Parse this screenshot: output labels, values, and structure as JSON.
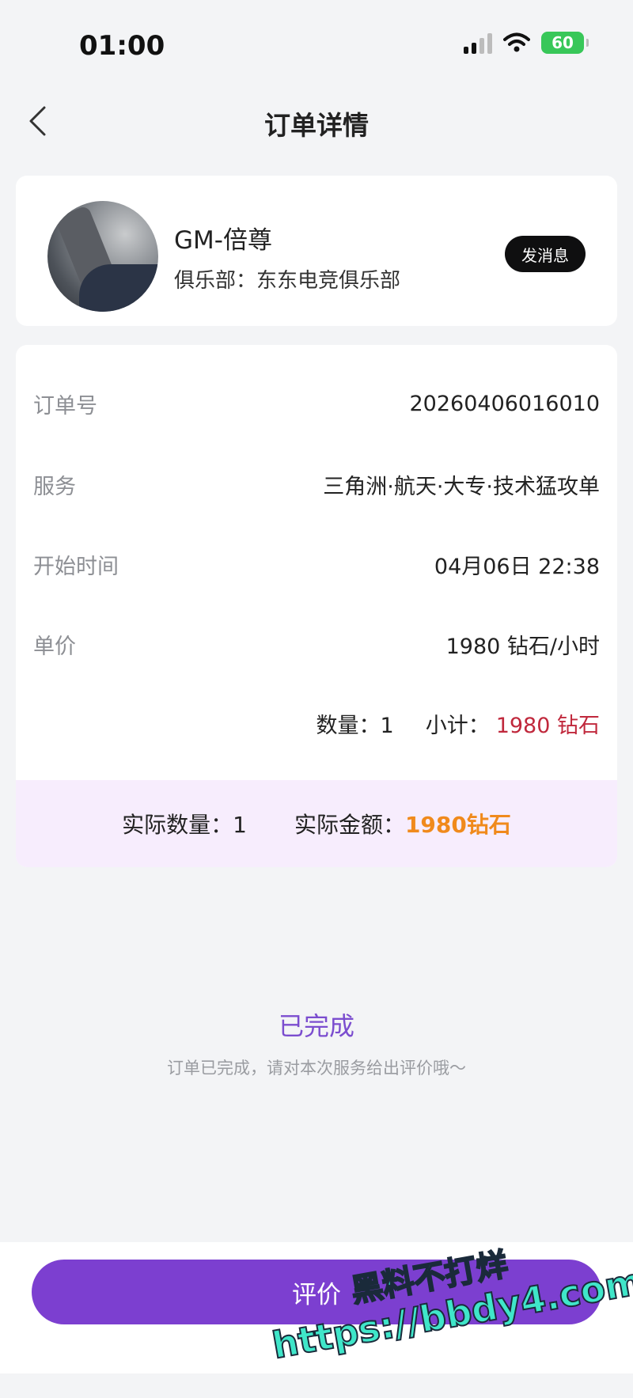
{
  "status_bar": {
    "time": "01:00",
    "battery": "60",
    "signal_icon": "cellular-signal-icon",
    "wifi_icon": "wifi-icon"
  },
  "nav": {
    "title": "订单详情",
    "back_icon": "chevron-left-icon"
  },
  "profile": {
    "name": "GM-倍尊",
    "club": "俱乐部：东东电竞俱乐部",
    "message_button": "发消息"
  },
  "order": {
    "rows": [
      {
        "label": "订单号",
        "value": "20260406016010"
      },
      {
        "label": "服务",
        "value": "三角洲·航天·大专·技术猛攻单"
      },
      {
        "label": "开始时间",
        "value": "04月06日  22:38"
      },
      {
        "label": "单价",
        "value": "1980 钻石/小时"
      }
    ],
    "quantity": "数量：1",
    "subtotal_label": "小计：",
    "subtotal_value": "1980 钻石"
  },
  "actual": {
    "quantity": "实际数量：1",
    "amount_label": "实际金额：",
    "amount_value": "1980钻石"
  },
  "status": {
    "title": "已完成",
    "description": "订单已完成，请对本次服务给出评价哦～"
  },
  "bottom": {
    "review_button": "评价"
  },
  "watermark": {
    "line1": "黑料不打烊",
    "line2": "https://bbdy4.com"
  },
  "colors": {
    "accent_purple": "#7c3fd0",
    "subtotal_red": "#c0283c",
    "amount_orange": "#f08a1c",
    "actual_bar_bg": "#f7edfd"
  }
}
